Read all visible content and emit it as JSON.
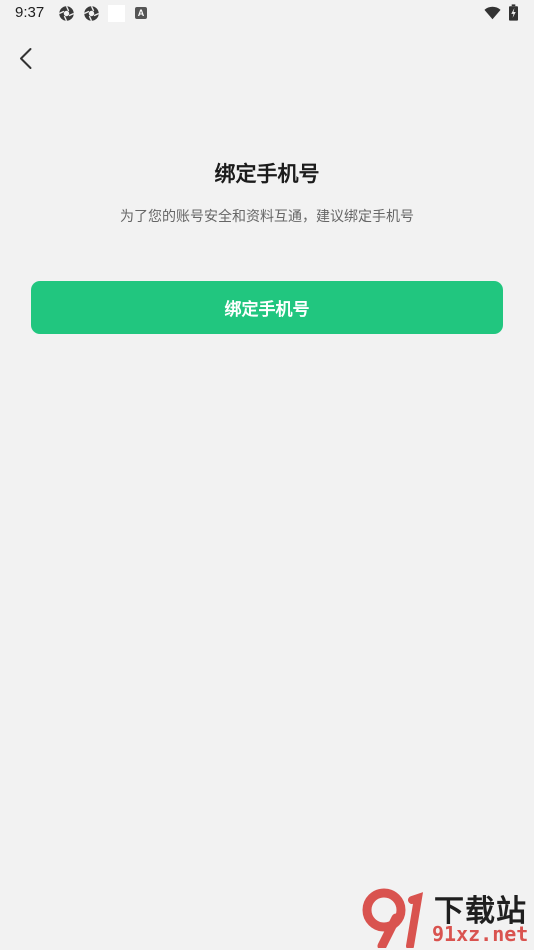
{
  "status_bar": {
    "time": "9:37",
    "indicator_label": "A",
    "icons": [
      "aperture-icon",
      "aperture-icon",
      "white-square-icon",
      "a-badge-icon",
      "wifi-icon",
      "battery-charging-icon"
    ]
  },
  "nav": {
    "back_icon": "chevron-left-icon"
  },
  "main": {
    "title": "绑定手机号",
    "subtitle": "为了您的账号安全和资料互通，建议绑定手机号",
    "bind_button_label": "绑定手机号"
  },
  "watermark": {
    "logo_text": "91",
    "chinese_text": "下载站",
    "url_text": "91xz.net"
  },
  "colors": {
    "background": "#f2f2f2",
    "accent": "#21c67f",
    "title": "#1c1c1c",
    "subtitle": "#666666",
    "watermark_red": "#d9534f"
  }
}
